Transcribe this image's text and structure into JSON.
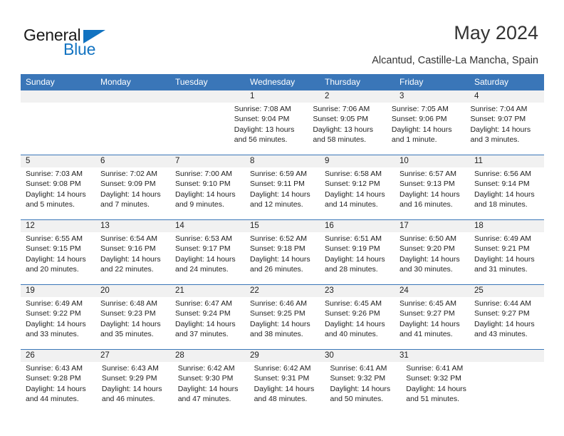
{
  "brand": {
    "name_part1": "General",
    "name_part2": "Blue",
    "accent_color": "#1273c1"
  },
  "header": {
    "title": "May 2024",
    "location": "Alcantud, Castille-La Mancha, Spain"
  },
  "calendar": {
    "header_bg": "#3a76b8",
    "weekday_headers": [
      "Sunday",
      "Monday",
      "Tuesday",
      "Wednesday",
      "Thursday",
      "Friday",
      "Saturday"
    ],
    "weeks": [
      [
        {
          "blank": true
        },
        {
          "blank": true
        },
        {
          "blank": true
        },
        {
          "day": "1",
          "sunrise": "Sunrise: 7:08 AM",
          "sunset": "Sunset: 9:04 PM",
          "daylight": "Daylight: 13 hours and 56 minutes."
        },
        {
          "day": "2",
          "sunrise": "Sunrise: 7:06 AM",
          "sunset": "Sunset: 9:05 PM",
          "daylight": "Daylight: 13 hours and 58 minutes."
        },
        {
          "day": "3",
          "sunrise": "Sunrise: 7:05 AM",
          "sunset": "Sunset: 9:06 PM",
          "daylight": "Daylight: 14 hours and 1 minute."
        },
        {
          "day": "4",
          "sunrise": "Sunrise: 7:04 AM",
          "sunset": "Sunset: 9:07 PM",
          "daylight": "Daylight: 14 hours and 3 minutes."
        }
      ],
      [
        {
          "day": "5",
          "sunrise": "Sunrise: 7:03 AM",
          "sunset": "Sunset: 9:08 PM",
          "daylight": "Daylight: 14 hours and 5 minutes."
        },
        {
          "day": "6",
          "sunrise": "Sunrise: 7:02 AM",
          "sunset": "Sunset: 9:09 PM",
          "daylight": "Daylight: 14 hours and 7 minutes."
        },
        {
          "day": "7",
          "sunrise": "Sunrise: 7:00 AM",
          "sunset": "Sunset: 9:10 PM",
          "daylight": "Daylight: 14 hours and 9 minutes."
        },
        {
          "day": "8",
          "sunrise": "Sunrise: 6:59 AM",
          "sunset": "Sunset: 9:11 PM",
          "daylight": "Daylight: 14 hours and 12 minutes."
        },
        {
          "day": "9",
          "sunrise": "Sunrise: 6:58 AM",
          "sunset": "Sunset: 9:12 PM",
          "daylight": "Daylight: 14 hours and 14 minutes."
        },
        {
          "day": "10",
          "sunrise": "Sunrise: 6:57 AM",
          "sunset": "Sunset: 9:13 PM",
          "daylight": "Daylight: 14 hours and 16 minutes."
        },
        {
          "day": "11",
          "sunrise": "Sunrise: 6:56 AM",
          "sunset": "Sunset: 9:14 PM",
          "daylight": "Daylight: 14 hours and 18 minutes."
        }
      ],
      [
        {
          "day": "12",
          "sunrise": "Sunrise: 6:55 AM",
          "sunset": "Sunset: 9:15 PM",
          "daylight": "Daylight: 14 hours and 20 minutes."
        },
        {
          "day": "13",
          "sunrise": "Sunrise: 6:54 AM",
          "sunset": "Sunset: 9:16 PM",
          "daylight": "Daylight: 14 hours and 22 minutes."
        },
        {
          "day": "14",
          "sunrise": "Sunrise: 6:53 AM",
          "sunset": "Sunset: 9:17 PM",
          "daylight": "Daylight: 14 hours and 24 minutes."
        },
        {
          "day": "15",
          "sunrise": "Sunrise: 6:52 AM",
          "sunset": "Sunset: 9:18 PM",
          "daylight": "Daylight: 14 hours and 26 minutes."
        },
        {
          "day": "16",
          "sunrise": "Sunrise: 6:51 AM",
          "sunset": "Sunset: 9:19 PM",
          "daylight": "Daylight: 14 hours and 28 minutes."
        },
        {
          "day": "17",
          "sunrise": "Sunrise: 6:50 AM",
          "sunset": "Sunset: 9:20 PM",
          "daylight": "Daylight: 14 hours and 30 minutes."
        },
        {
          "day": "18",
          "sunrise": "Sunrise: 6:49 AM",
          "sunset": "Sunset: 9:21 PM",
          "daylight": "Daylight: 14 hours and 31 minutes."
        }
      ],
      [
        {
          "day": "19",
          "sunrise": "Sunrise: 6:49 AM",
          "sunset": "Sunset: 9:22 PM",
          "daylight": "Daylight: 14 hours and 33 minutes."
        },
        {
          "day": "20",
          "sunrise": "Sunrise: 6:48 AM",
          "sunset": "Sunset: 9:23 PM",
          "daylight": "Daylight: 14 hours and 35 minutes."
        },
        {
          "day": "21",
          "sunrise": "Sunrise: 6:47 AM",
          "sunset": "Sunset: 9:24 PM",
          "daylight": "Daylight: 14 hours and 37 minutes."
        },
        {
          "day": "22",
          "sunrise": "Sunrise: 6:46 AM",
          "sunset": "Sunset: 9:25 PM",
          "daylight": "Daylight: 14 hours and 38 minutes."
        },
        {
          "day": "23",
          "sunrise": "Sunrise: 6:45 AM",
          "sunset": "Sunset: 9:26 PM",
          "daylight": "Daylight: 14 hours and 40 minutes."
        },
        {
          "day": "24",
          "sunrise": "Sunrise: 6:45 AM",
          "sunset": "Sunset: 9:27 PM",
          "daylight": "Daylight: 14 hours and 41 minutes."
        },
        {
          "day": "25",
          "sunrise": "Sunrise: 6:44 AM",
          "sunset": "Sunset: 9:27 PM",
          "daylight": "Daylight: 14 hours and 43 minutes."
        }
      ],
      [
        {
          "day": "26",
          "sunrise": "Sunrise: 6:43 AM",
          "sunset": "Sunset: 9:28 PM",
          "daylight": "Daylight: 14 hours and 44 minutes."
        },
        {
          "day": "27",
          "sunrise": "Sunrise: 6:43 AM",
          "sunset": "Sunset: 9:29 PM",
          "daylight": "Daylight: 14 hours and 46 minutes."
        },
        {
          "day": "28",
          "sunrise": "Sunrise: 6:42 AM",
          "sunset": "Sunset: 9:30 PM",
          "daylight": "Daylight: 14 hours and 47 minutes."
        },
        {
          "day": "29",
          "sunrise": "Sunrise: 6:42 AM",
          "sunset": "Sunset: 9:31 PM",
          "daylight": "Daylight: 14 hours and 48 minutes."
        },
        {
          "day": "30",
          "sunrise": "Sunrise: 6:41 AM",
          "sunset": "Sunset: 9:32 PM",
          "daylight": "Daylight: 14 hours and 50 minutes."
        },
        {
          "day": "31",
          "sunrise": "Sunrise: 6:41 AM",
          "sunset": "Sunset: 9:32 PM",
          "daylight": "Daylight: 14 hours and 51 minutes."
        },
        {
          "blank": true
        }
      ]
    ]
  }
}
